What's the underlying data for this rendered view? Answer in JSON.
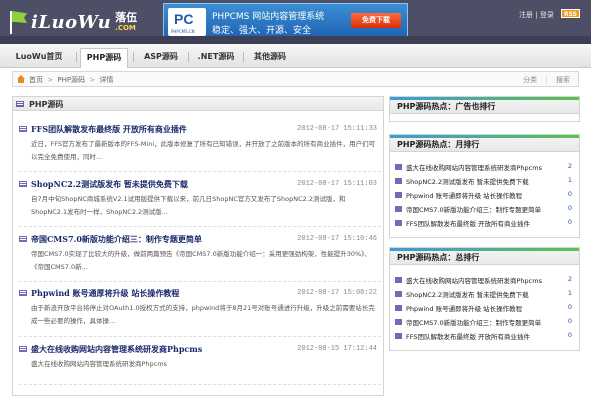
{
  "site": {
    "logo_text": "iLuoWu",
    "logo_cn": "落伍",
    "logo_com": ".COM"
  },
  "banner": {
    "logo_main": "PC",
    "logo_sub": "PHPCMS.CN",
    "title": "PHPCMS 网站内容管理系统",
    "slogan": "稳定、强大、开源、安全",
    "button": "免费下载"
  },
  "toplinks": {
    "register": "注册",
    "separator": "|",
    "login": "登录",
    "rss": "RSS"
  },
  "nav": {
    "items": [
      {
        "label": "LuoWu首页",
        "active": false
      },
      {
        "label": "PHP源码",
        "active": true
      },
      {
        "label": "ASP源码",
        "active": false
      },
      {
        "label": ".NET源码",
        "active": false
      },
      {
        "label": "其他源码",
        "active": false
      }
    ]
  },
  "breadcrumb": {
    "items": [
      "首页",
      "PHP源码",
      "详情"
    ],
    "separator": ">",
    "right_category": "分类",
    "right_search": "搜索"
  },
  "main": {
    "section_title": "PHP源码",
    "articles": [
      {
        "title": "FFS团队解散发布最终版 开放所有商业插件",
        "date": "2012-08-17 15:11:33",
        "summary": "近日，FFS官方发布了最新版本的FFS-Mini，此版本修复了所有已知错误，并开放了之前版本的所有商业插件，用户们可以完全免费使用，同时..."
      },
      {
        "title": "ShopNC2.2测试版发布 暂未提供免费下载",
        "date": "2012-08-17 15:11:03",
        "summary": "自7月中旬ShopNC商城系统V2.1试用版提供下载以来，前几日ShopNC官方又发布了ShopNC2.2测试版，和ShopNC2.1发布时一样，ShopNC2.2测试版..."
      },
      {
        "title": "帝国CMS7.0新版功能介绍三：制作专题更简单",
        "date": "2012-08-17 15:10:46",
        "summary": "帝国CMS7.0实现了比较大的升级，做前两篇预告《帝国CMS7.0新版功能介绍一：采用更强劲构架，性能提升30%》、《帝国CMS7.0新..."
      },
      {
        "title": "Phpwind 账号通厚将升级 站长操作教程",
        "date": "2012-08-17 15:08:22",
        "summary": "由于新浪开放平台将停止对OAuth1.0授权方式的支持，phpwind将于8月21号对账号通进行升级，升级之前需要站长完成一些必要的操作，具体操..."
      },
      {
        "title": "盛大在线收购网站内容管理系统研发商Phpcms",
        "date": "2012-08-15 17:12:44",
        "summary": "盛大在线收购网站内容管理系统研发商Phpcms"
      }
    ]
  },
  "sidebar": {
    "ad_title": "PHP源码热点：广告也排行",
    "monthly": {
      "title": "PHP源码热点：月排行",
      "items": [
        {
          "title": "盛大在线收购网站内容管理系统研发商Phpcms",
          "count": "2"
        },
        {
          "title": "ShopNC2.2测试版发布 暂未提供免费下载",
          "count": "1"
        },
        {
          "title": "Phpwind 账号通即将升级 站长操作教程",
          "count": "0"
        },
        {
          "title": "帝国CMS7.0新版功能介绍三：制作专题更简单",
          "count": "0"
        },
        {
          "title": "FFS团队解散发布最终版 开放所有商业插件",
          "count": "0"
        }
      ]
    },
    "total": {
      "title": "PHP源码热点：总排行",
      "items": [
        {
          "title": "盛大在线收购网站内容管理系统研发商Phpcms",
          "count": "2"
        },
        {
          "title": "ShopNC2.2测试版发布 暂未提供免费下载",
          "count": "1"
        },
        {
          "title": "Phpwind 账号通即将升级 站长操作教程",
          "count": "0"
        },
        {
          "title": "帝国CMS7.0新版功能介绍三：制作专题更简单",
          "count": "0"
        },
        {
          "title": "FFS团队解散发布最终版 开放所有商业插件",
          "count": "0"
        }
      ]
    }
  },
  "colors": {
    "header_bg": "#4d4f66",
    "article_title": "#1a2a6b",
    "rank_count": "#2255aa",
    "rss": "#f39a1c"
  },
  "icons": {
    "logo": "flag-icon",
    "home": "home-icon",
    "section": "list-icon",
    "article": "article-icon"
  }
}
